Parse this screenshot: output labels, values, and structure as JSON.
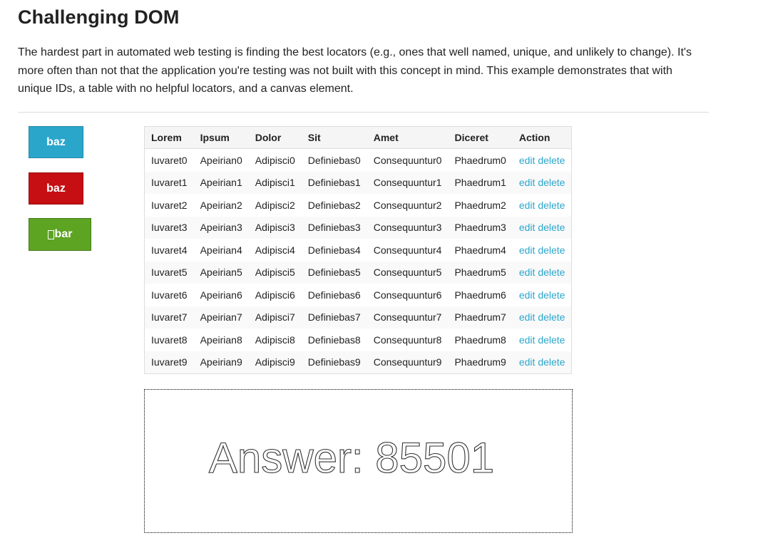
{
  "header": {
    "title": "Challenging DOM"
  },
  "description": "The hardest part in automated web testing is finding the best locators (e.g., ones that well named, unique, and unlikely to change). It's more often than not that the application you're testing was not built with this concept in mind. This example demonstrates that with unique IDs, a table with no helpful locators, and a canvas element.",
  "buttons": [
    {
      "label": "baz",
      "color": "#2ba6cb"
    },
    {
      "label": "baz",
      "color": "#c60f13"
    },
    {
      "label": "bar",
      "color": "#5da423",
      "icon": "missing-glyph-icon"
    }
  ],
  "table": {
    "headers": [
      "Lorem",
      "Ipsum",
      "Dolor",
      "Sit",
      "Amet",
      "Diceret",
      "Action"
    ],
    "rows": [
      [
        "Iuvaret0",
        "Apeirian0",
        "Adipisci0",
        "Definiebas0",
        "Consequuntur0",
        "Phaedrum0"
      ],
      [
        "Iuvaret1",
        "Apeirian1",
        "Adipisci1",
        "Definiebas1",
        "Consequuntur1",
        "Phaedrum1"
      ],
      [
        "Iuvaret2",
        "Apeirian2",
        "Adipisci2",
        "Definiebas2",
        "Consequuntur2",
        "Phaedrum2"
      ],
      [
        "Iuvaret3",
        "Apeirian3",
        "Adipisci3",
        "Definiebas3",
        "Consequuntur3",
        "Phaedrum3"
      ],
      [
        "Iuvaret4",
        "Apeirian4",
        "Adipisci4",
        "Definiebas4",
        "Consequuntur4",
        "Phaedrum4"
      ],
      [
        "Iuvaret5",
        "Apeirian5",
        "Adipisci5",
        "Definiebas5",
        "Consequuntur5",
        "Phaedrum5"
      ],
      [
        "Iuvaret6",
        "Apeirian6",
        "Adipisci6",
        "Definiebas6",
        "Consequuntur6",
        "Phaedrum6"
      ],
      [
        "Iuvaret7",
        "Apeirian7",
        "Adipisci7",
        "Definiebas7",
        "Consequuntur7",
        "Phaedrum7"
      ],
      [
        "Iuvaret8",
        "Apeirian8",
        "Adipisci8",
        "Definiebas8",
        "Consequuntur8",
        "Phaedrum8"
      ],
      [
        "Iuvaret9",
        "Apeirian9",
        "Adipisci9",
        "Definiebas9",
        "Consequuntur9",
        "Phaedrum9"
      ]
    ],
    "actions": {
      "edit": "edit",
      "delete": "delete"
    }
  },
  "canvas": {
    "text": "Answer: 85501"
  }
}
